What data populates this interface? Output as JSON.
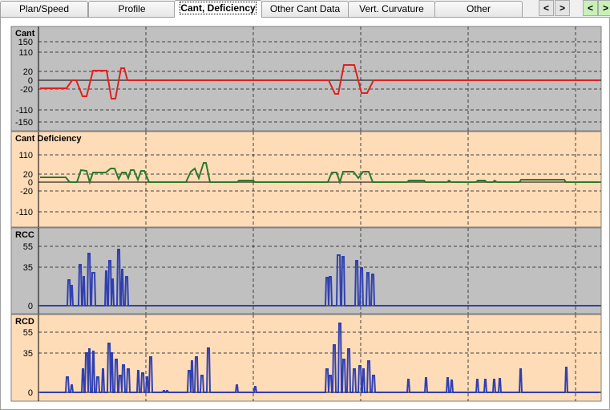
{
  "tabs": [
    {
      "label": "Plan/Speed"
    },
    {
      "label": "Profile"
    },
    {
      "label": "Cant, Deficiency",
      "active": true
    },
    {
      "label": "Other Cant Data"
    },
    {
      "label": "Vert. Curvature"
    },
    {
      "label": "Other"
    }
  ],
  "nav": {
    "prev": "<",
    "next": ">",
    "prev2": "<",
    "next2": ">"
  },
  "panels": [
    {
      "title": "Cant",
      "bg": "#c0c0c0",
      "line_color": "#e02020",
      "ticks": [
        "150",
        "110",
        "20",
        "0",
        "-20",
        "-110",
        "-150"
      ]
    },
    {
      "title": "Cant Deficiency",
      "bg": "#ffdcb8",
      "line_color": "#2a7a2a",
      "ticks": [
        "110",
        "20",
        "0",
        "-20",
        "-110"
      ]
    },
    {
      "title": "RCC",
      "bg": "#c0c0c0",
      "line_color": "#3040b0",
      "ticks": [
        "55",
        "35",
        "0"
      ]
    },
    {
      "title": "RCD",
      "bg": "#ffdcb8",
      "line_color": "#3040b0",
      "ticks": [
        "55",
        "35",
        "0"
      ]
    }
  ]
}
